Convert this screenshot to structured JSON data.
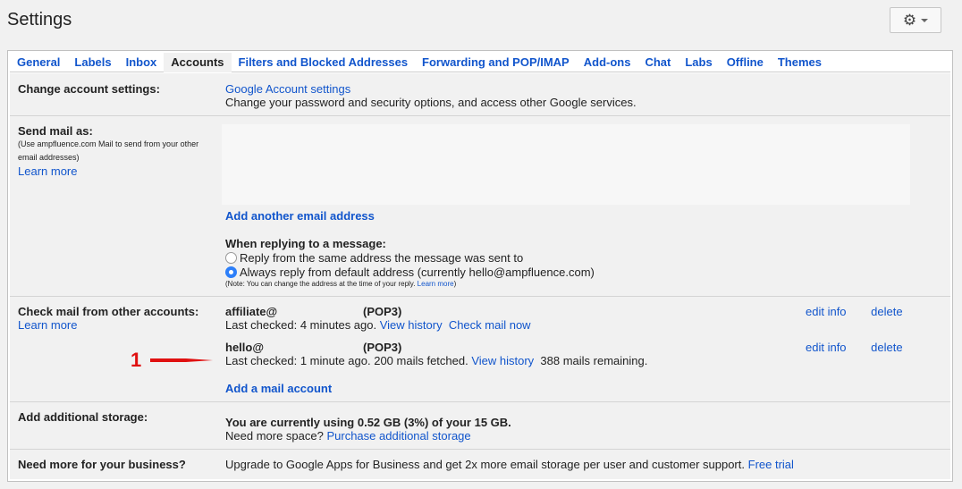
{
  "header": {
    "title": "Settings",
    "gear_icon": "gear-icon"
  },
  "tabs": [
    "General",
    "Labels",
    "Inbox",
    "Accounts",
    "Filters and Blocked Addresses",
    "Forwarding and POP/IMAP",
    "Add-ons",
    "Chat",
    "Labs",
    "Offline",
    "Themes"
  ],
  "active_tab": "Accounts",
  "change_account": {
    "label": "Change account settings:",
    "link": "Google Account settings",
    "desc": "Change your password and security options, and access other Google services."
  },
  "send_mail": {
    "label": "Send mail as:",
    "note": "(Use ampfluence.com Mail to send from your other email addresses)",
    "learn_more": "Learn more",
    "add_address": "Add another email address",
    "reply_heading": "When replying to a message:",
    "option1": "Reply from the same address the message was sent to",
    "option2": "Always reply from default address (currently hello@ampfluence.com)",
    "reply_note": "(Note: You can change the address at the time of your reply.",
    "reply_note_link": "Learn more",
    "reply_note_end": ")"
  },
  "check_mail": {
    "label": "Check mail from other accounts:",
    "learn_more": "Learn more",
    "accounts": [
      {
        "name": "affiliate@",
        "type": "(POP3)",
        "status": "Last checked: 4 minutes ago.",
        "link1": "View history",
        "link2": "Check mail now",
        "extra": "",
        "edit": "edit info",
        "delete": "delete"
      },
      {
        "name": "hello@",
        "type": "(POP3)",
        "status": "Last checked: 1 minute ago. 200 mails fetched.",
        "link1": "View history",
        "link2": "",
        "extra": "388 mails remaining.",
        "edit": "edit info",
        "delete": "delete"
      }
    ],
    "add_account": "Add a mail account"
  },
  "annotation": {
    "number": "1",
    "color": "#e01010"
  },
  "storage": {
    "label": "Add additional storage:",
    "usage": "You are currently using 0.52 GB (3%) of your 15 GB.",
    "need_more": "Need more space?",
    "link": "Purchase additional storage"
  },
  "business": {
    "label": "Need more for your business?",
    "desc": "Upgrade to Google Apps for Business and get 2x more email storage per user and customer support.",
    "link": "Free trial"
  }
}
